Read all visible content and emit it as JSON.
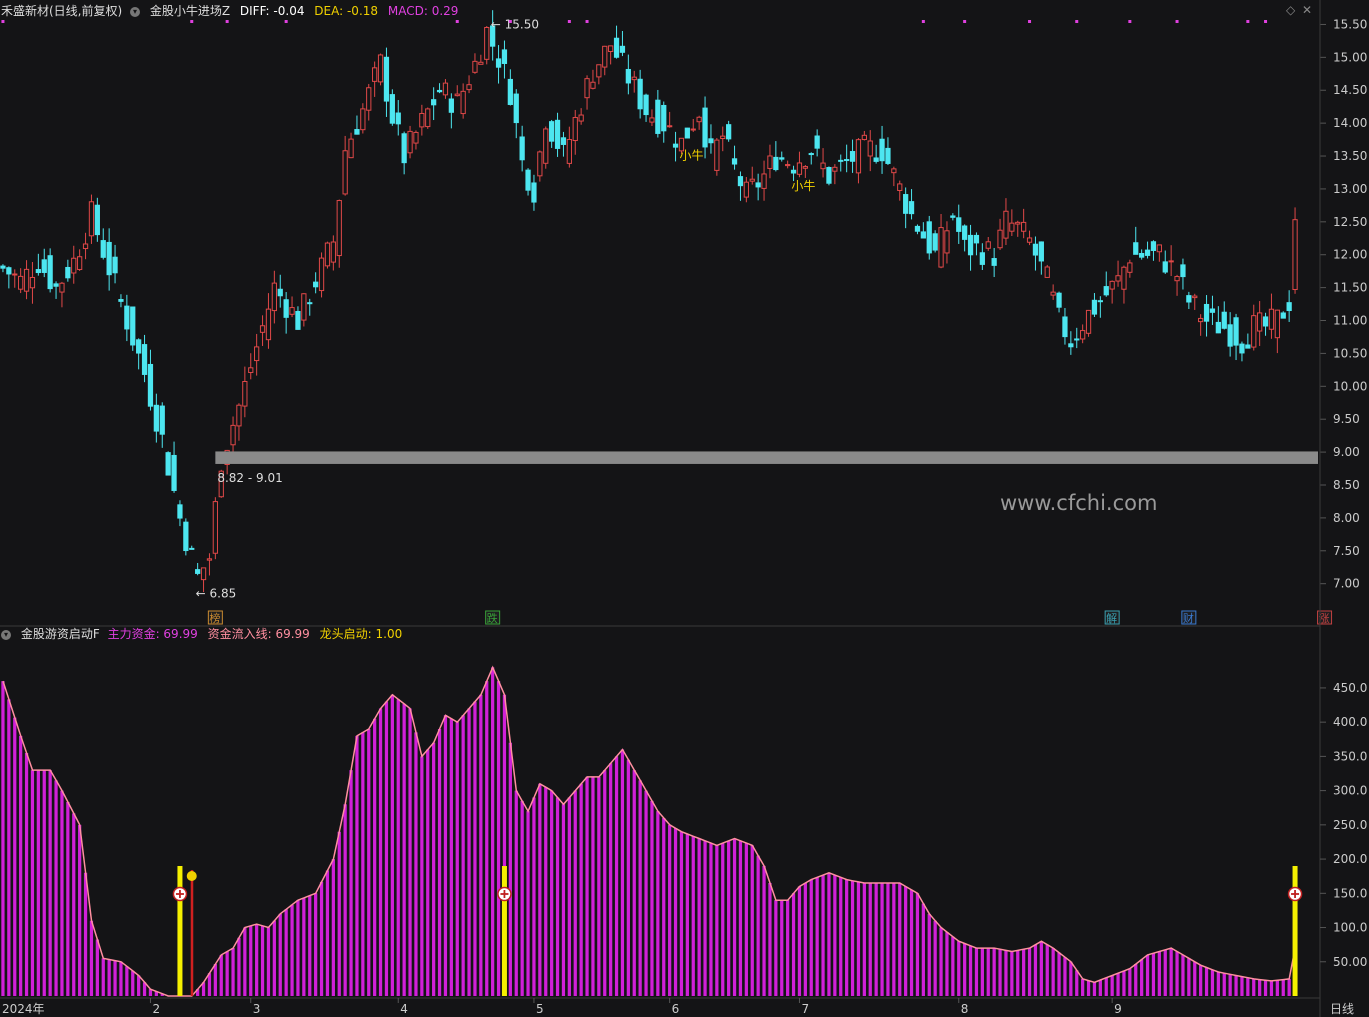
{
  "header": {
    "stock_name": "禾盛新材(日线,前复权)",
    "indicator": "金股小牛进场Z",
    "diff": "DIFF: -0.04",
    "dea": "DEA: -0.18",
    "macd": "MACD: 0.29",
    "colors": {
      "diff": "#ffffff",
      "dea": "#f0d000",
      "macd": "#e040e0"
    }
  },
  "sub_header": {
    "indicator": "金股游资启动F",
    "main_fund": "主力资金: 69.99",
    "inflow_line": "资金流入线: 69.99",
    "leader_start": "龙头启动: 1.00"
  },
  "watermark": "www.cfchi.com",
  "period_label": "日线",
  "chart_data": [
    {
      "type": "candlestick",
      "name": "price",
      "y_ticks": [
        "15.50",
        "15.00",
        "14.50",
        "14.00",
        "13.50",
        "13.00",
        "12.50",
        "12.00",
        "11.50",
        "11.00",
        "10.50",
        "10.00",
        "9.50",
        "9.00",
        "8.50",
        "8.00",
        "7.50",
        "7.00"
      ],
      "ylim": [
        6.6,
        15.75
      ],
      "annotations": {
        "high": "15.50",
        "low": "6.85",
        "zone_label": "8.82 - 9.01"
      },
      "zone": [
        8.82,
        9.01
      ],
      "signals": [
        "小牛",
        "小牛",
        "小牛"
      ],
      "signal_x": [
        115,
        136,
        241,
        256
      ],
      "event_labels": [
        "榜",
        "跌",
        "解",
        "财",
        "涨"
      ],
      "event_x": [
        36,
        83,
        188,
        201,
        224
      ],
      "colors": {
        "up": "#e04848",
        "down": "#4de6f0",
        "zone": "#8a8a8a",
        "signal": "#f0d000"
      },
      "close_anchors": [
        [
          0,
          11.8
        ],
        [
          3,
          11.6
        ],
        [
          6,
          11.9
        ],
        [
          9,
          11.5
        ],
        [
          12,
          11.9
        ],
        [
          15,
          12.6
        ],
        [
          18,
          11.8
        ],
        [
          21,
          11.0
        ],
        [
          24,
          10.2
        ],
        [
          27,
          9.2
        ],
        [
          30,
          8.0
        ],
        [
          33,
          7.1
        ],
        [
          35,
          7.4
        ],
        [
          37,
          8.9
        ],
        [
          40,
          9.7
        ],
        [
          43,
          10.6
        ],
        [
          46,
          11.5
        ],
        [
          50,
          11.0
        ],
        [
          53,
          11.6
        ],
        [
          56,
          12.2
        ],
        [
          58,
          13.6
        ],
        [
          61,
          14.2
        ],
        [
          64,
          14.9
        ],
        [
          66,
          14.1
        ],
        [
          68,
          13.5
        ],
        [
          71,
          14.0
        ],
        [
          74,
          14.5
        ],
        [
          77,
          14.3
        ],
        [
          80,
          14.9
        ],
        [
          82,
          15.4
        ],
        [
          84,
          15.0
        ],
        [
          86,
          14.5
        ],
        [
          88,
          13.4
        ],
        [
          90,
          13.0
        ],
        [
          92,
          14.1
        ],
        [
          95,
          13.5
        ],
        [
          98,
          14.3
        ],
        [
          100,
          14.8
        ],
        [
          103,
          15.2
        ],
        [
          106,
          14.7
        ],
        [
          109,
          14.2
        ],
        [
          112,
          14.0
        ],
        [
          115,
          13.7
        ],
        [
          118,
          14.2
        ],
        [
          120,
          13.5
        ],
        [
          122,
          13.8
        ],
        [
          124,
          13.3
        ],
        [
          126,
          12.9
        ],
        [
          129,
          13.2
        ],
        [
          131,
          13.5
        ],
        [
          134,
          13.4
        ],
        [
          137,
          13.6
        ],
        [
          140,
          13.2
        ],
        [
          143,
          13.4
        ],
        [
          146,
          13.6
        ],
        [
          149,
          13.6
        ],
        [
          152,
          13.0
        ],
        [
          154,
          12.6
        ],
        [
          156,
          12.3
        ],
        [
          158,
          12.0
        ],
        [
          161,
          12.6
        ],
        [
          163,
          12.1
        ],
        [
          165,
          12.1
        ],
        [
          168,
          12.0
        ],
        [
          170,
          12.5
        ],
        [
          172,
          12.4
        ],
        [
          174,
          12.2
        ],
        [
          177,
          11.6
        ],
        [
          179,
          11.0
        ],
        [
          181,
          10.7
        ],
        [
          184,
          11.1
        ],
        [
          186,
          11.3
        ],
        [
          189,
          11.6
        ],
        [
          191,
          12.0
        ],
        [
          194,
          12.0
        ],
        [
          196,
          12.0
        ],
        [
          199,
          11.7
        ],
        [
          201,
          11.3
        ],
        [
          204,
          11.0
        ],
        [
          207,
          10.9
        ],
        [
          210,
          10.7
        ],
        [
          212,
          10.9
        ],
        [
          214,
          10.9
        ],
        [
          216,
          11.0
        ],
        [
          218,
          11.3
        ],
        [
          219,
          12.6
        ]
      ],
      "series_name": "主力资金",
      "fund_anchors": [
        [
          0,
          460
        ],
        [
          3,
          380
        ],
        [
          5,
          330
        ],
        [
          8,
          330
        ],
        [
          10,
          300
        ],
        [
          13,
          250
        ],
        [
          15,
          110
        ],
        [
          17,
          55
        ],
        [
          20,
          50
        ],
        [
          23,
          30
        ],
        [
          25,
          10
        ],
        [
          28,
          0
        ],
        [
          32,
          0
        ],
        [
          34,
          20
        ],
        [
          37,
          60
        ],
        [
          39,
          70
        ],
        [
          41,
          100
        ],
        [
          43,
          105
        ],
        [
          45,
          100
        ],
        [
          47,
          120
        ],
        [
          50,
          140
        ],
        [
          53,
          150
        ],
        [
          56,
          200
        ],
        [
          58,
          280
        ],
        [
          60,
          380
        ],
        [
          62,
          390
        ],
        [
          64,
          420
        ],
        [
          66,
          440
        ],
        [
          69,
          420
        ],
        [
          71,
          350
        ],
        [
          73,
          370
        ],
        [
          75,
          410
        ],
        [
          77,
          400
        ],
        [
          79,
          420
        ],
        [
          81,
          440
        ],
        [
          83,
          480
        ],
        [
          85,
          440
        ],
        [
          87,
          300
        ],
        [
          89,
          270
        ],
        [
          91,
          310
        ],
        [
          93,
          300
        ],
        [
          95,
          280
        ],
        [
          97,
          300
        ],
        [
          99,
          320
        ],
        [
          101,
          320
        ],
        [
          103,
          340
        ],
        [
          105,
          360
        ],
        [
          107,
          330
        ],
        [
          109,
          300
        ],
        [
          111,
          270
        ],
        [
          113,
          250
        ],
        [
          115,
          240
        ],
        [
          118,
          230
        ],
        [
          121,
          220
        ],
        [
          124,
          230
        ],
        [
          127,
          220
        ],
        [
          129,
          190
        ],
        [
          131,
          140
        ],
        [
          133,
          140
        ],
        [
          135,
          160
        ],
        [
          137,
          170
        ],
        [
          140,
          180
        ],
        [
          143,
          170
        ],
        [
          146,
          165
        ],
        [
          149,
          165
        ],
        [
          152,
          165
        ],
        [
          155,
          150
        ],
        [
          157,
          120
        ],
        [
          159,
          100
        ],
        [
          162,
          80
        ],
        [
          165,
          70
        ],
        [
          168,
          70
        ],
        [
          171,
          65
        ],
        [
          174,
          70
        ],
        [
          176,
          80
        ],
        [
          178,
          70
        ],
        [
          181,
          50
        ],
        [
          183,
          25
        ],
        [
          185,
          20
        ],
        [
          188,
          30
        ],
        [
          191,
          40
        ],
        [
          194,
          60
        ],
        [
          196,
          65
        ],
        [
          198,
          70
        ],
        [
          200,
          60
        ],
        [
          203,
          45
        ],
        [
          206,
          35
        ],
        [
          209,
          30
        ],
        [
          212,
          25
        ],
        [
          215,
          22
        ],
        [
          218,
          25
        ],
        [
          219,
          69.99
        ]
      ],
      "sub_y_ticks": [
        "450.0",
        "400.0",
        "350.0",
        "300.0",
        "250.0",
        "200.0",
        "150.0",
        "100.0",
        "50.00"
      ],
      "sub_ylim": [
        0,
        520
      ],
      "start_markers_x": [
        30,
        85,
        219
      ],
      "x_labels": [
        "2024年",
        "2",
        "3",
        "4",
        "5",
        "6",
        "7",
        "8",
        "9"
      ],
      "x_label_positions": [
        0,
        25,
        42,
        67,
        90,
        113,
        135,
        162,
        188
      ],
      "bar_count": 220
    }
  ]
}
